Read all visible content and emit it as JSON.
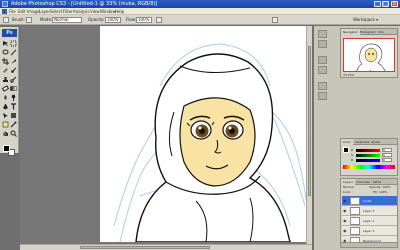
{
  "window": {
    "title": "Adobe Photoshop CS3 - [Untitled-1 @ 33% (muka, RGB/8)]",
    "minimize": "_",
    "maximize": "□",
    "close": "x"
  },
  "menu": [
    "File",
    "Edit",
    "Image",
    "Layer",
    "Select",
    "Filter",
    "Analysis",
    "View",
    "Window",
    "Help"
  ],
  "options_bar": {
    "brush_label": "Brush:",
    "mode_label": "Mode:",
    "mode_value": "Normal",
    "opacity_label": "Opacity:",
    "opacity_value": "100%",
    "flow_label": "Flow:",
    "flow_value": "100%",
    "workspace_label": "Workspace ▾"
  },
  "toolbox": {
    "logo": "Ps",
    "tools": [
      "move-tool",
      "marquee-tool",
      "lasso-tool",
      "magic-wand-tool",
      "crop-tool",
      "slice-tool",
      "healing-tool",
      "brush-tool",
      "stamp-tool",
      "history-brush-tool",
      "eraser-tool",
      "gradient-tool",
      "blur-tool",
      "dodge-tool",
      "pen-tool",
      "type-tool",
      "path-select-tool",
      "shape-tool",
      "notes-tool",
      "eyedropper-tool",
      "hand-tool",
      "zoom-tool"
    ],
    "foreground_color": "#000000",
    "background_color": "#ffffff"
  },
  "navigator": {
    "tabs": [
      "Navigator",
      "Histogram",
      "Info"
    ],
    "zoom": "33.33%"
  },
  "color_panel": {
    "tabs": [
      "Color",
      "Swatches",
      "Styles"
    ],
    "channels": [
      {
        "label": "R",
        "value": "0"
      },
      {
        "label": "G",
        "value": "0"
      },
      {
        "label": "B",
        "value": "0"
      }
    ]
  },
  "layers_panel": {
    "tabs": [
      "Layers",
      "Channels",
      "Paths"
    ],
    "blend_mode": "Normal",
    "opacity_label": "Opacity: 100%",
    "lock_label": "Lock:",
    "fill_label": "Fill: 100%",
    "layers": [
      {
        "name": "muka",
        "selected": true
      },
      {
        "name": "Layer 3",
        "selected": false
      },
      {
        "name": "Layer 2",
        "selected": false
      },
      {
        "name": "Layer 1",
        "selected": false
      },
      {
        "name": "Background",
        "selected": false
      }
    ]
  },
  "colors": {
    "titlebar": "#2b5fc4",
    "skin": "#f8e2a4",
    "hijab_outline": "#9ec8e6",
    "layer_selected": "#3a6fd1"
  }
}
